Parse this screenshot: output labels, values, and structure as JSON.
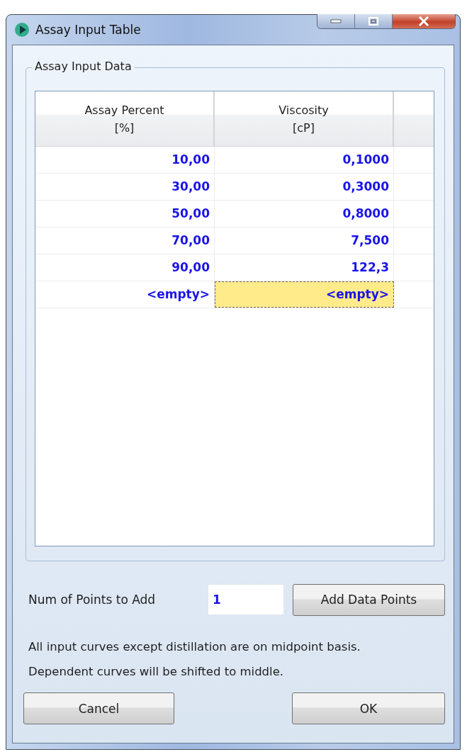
{
  "window": {
    "title": "Assay Input Table"
  },
  "group": {
    "title": "Assay Input Data"
  },
  "table": {
    "columns": [
      {
        "label": "Assay Percent",
        "unit": "[%]"
      },
      {
        "label": "Viscosity",
        "unit": "[cP]"
      }
    ],
    "rows": [
      {
        "cells": [
          {
            "text": "10,00",
            "selected": false
          },
          {
            "text": "0,1000",
            "selected": false
          }
        ]
      },
      {
        "cells": [
          {
            "text": "30,00",
            "selected": false
          },
          {
            "text": "0,3000",
            "selected": false
          }
        ]
      },
      {
        "cells": [
          {
            "text": "50,00",
            "selected": false
          },
          {
            "text": "0,8000",
            "selected": false
          }
        ]
      },
      {
        "cells": [
          {
            "text": "70,00",
            "selected": false
          },
          {
            "text": "7,500",
            "selected": false
          }
        ]
      },
      {
        "cells": [
          {
            "text": "90,00",
            "selected": false
          },
          {
            "text": "122,3",
            "selected": false
          }
        ]
      },
      {
        "cells": [
          {
            "text": "<empty>",
            "selected": false
          },
          {
            "text": "<empty>",
            "selected": true
          }
        ]
      }
    ]
  },
  "points": {
    "label": "Num of Points to Add",
    "value": "1",
    "button": "Add Data Points"
  },
  "note": "All input curves except distillation are on midpoint basis. Dependent curves will be shifted to middle.",
  "buttons": [
    "Cancel",
    "OK"
  ]
}
